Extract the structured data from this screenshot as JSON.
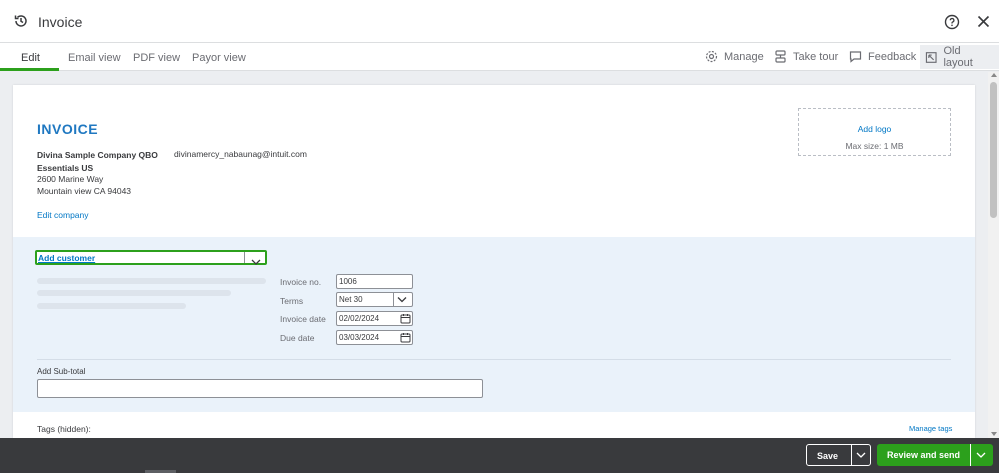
{
  "header": {
    "title": "Invoice"
  },
  "tabs": [
    {
      "label": "Edit"
    },
    {
      "label": "Email view"
    },
    {
      "label": "PDF view"
    },
    {
      "label": "Payor view"
    }
  ],
  "toolbar": {
    "manage": "Manage",
    "take_tour": "Take tour",
    "feedback": "Feedback",
    "old_layout": "Old layout"
  },
  "invoice": {
    "heading": "INVOICE",
    "company_name": "Divina Sample Company QBO Essentials US",
    "company_email": "divinamercy_nabaunag@intuit.com",
    "address_line1": "2600 Marine Way",
    "address_line2": "Mountain view CA 94043",
    "edit_company": "Edit company",
    "logo_add": "Add logo",
    "logo_size": "Max size: 1 MB"
  },
  "customer": {
    "placeholder": "Add customer"
  },
  "fields": {
    "invoice_no_label": "Invoice no.",
    "invoice_no_value": "1006",
    "terms_label": "Terms",
    "terms_value": "Net 30",
    "invoice_date_label": "Invoice date",
    "invoice_date_value": "02/02/2024",
    "due_date_label": "Due date",
    "due_date_value": "03/03/2024"
  },
  "subtotal": {
    "label": "Add Sub-total"
  },
  "tags": {
    "label": "Tags (hidden):",
    "manage": "Manage tags"
  },
  "footer": {
    "save": "Save",
    "review_send": "Review and send"
  },
  "colors": {
    "accent_green": "#2ca01c",
    "link_blue": "#0077c5",
    "heading_blue": "#1f78c1",
    "footer_bg": "#393a3d",
    "form_bg": "#eaf2fa"
  }
}
